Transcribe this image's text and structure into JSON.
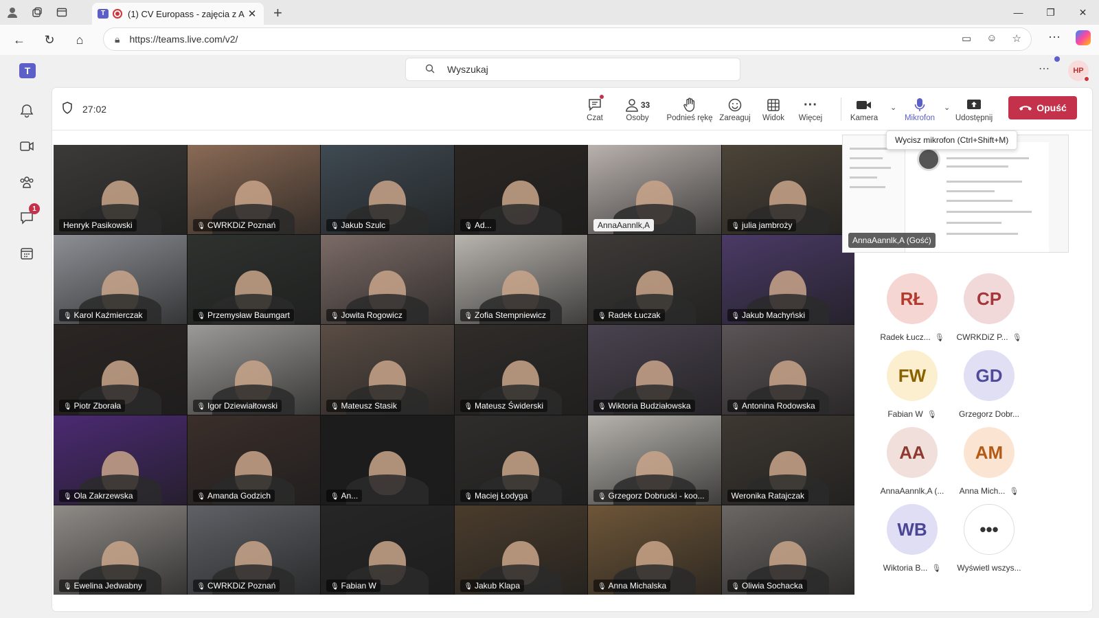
{
  "browser": {
    "tab_title": "(1) CV Europass - zajęcia z A",
    "url": "https://teams.live.com/v2/"
  },
  "teams": {
    "search_placeholder": "Wyszukaj",
    "user_initials": "HP",
    "chat_badge": "1"
  },
  "meeting": {
    "timer": "27:02",
    "people_count": "33",
    "toolbar": {
      "chat": "Czat",
      "people": "Osoby",
      "raise_hand": "Podnieś rękę",
      "react": "Zareaguj",
      "view": "Widok",
      "more": "Więcej",
      "camera": "Kamera",
      "mic": "Mikrofon",
      "share": "Udostępnij",
      "leave": "Opuść"
    },
    "tooltip": "Wycisz mikrofon (Ctrl+Shift+M)",
    "shared_label": "AnnaAannlk,A (Gość)",
    "tiles": [
      {
        "name": "Henryk Pasikowski",
        "muted": false,
        "bg": "#3b3a38",
        "light": false
      },
      {
        "name": "CWRKDiZ Poznań",
        "muted": true,
        "bg": "#8a6a55",
        "light": false
      },
      {
        "name": "Jakub Szulc",
        "muted": true,
        "bg": "#3f4a52",
        "light": false
      },
      {
        "name": "Ad...",
        "muted": true,
        "bg": "#2a2623",
        "light": false
      },
      {
        "name": "AnnaAannlk,A",
        "muted": false,
        "bg": "#b9b1ad",
        "light": true
      },
      {
        "name": "julia jambroży",
        "muted": true,
        "bg": "#4c4438",
        "light": false
      },
      {
        "name": "Karol Kaźmierczak",
        "muted": true,
        "bg": "#8c8f95",
        "light": false
      },
      {
        "name": "Przemysław Baumgart",
        "muted": true,
        "bg": "#2e322f",
        "light": false
      },
      {
        "name": "Jowita Rogowicz",
        "muted": true,
        "bg": "#7b6b66",
        "light": false
      },
      {
        "name": "Zofia Stempniewicz",
        "muted": true,
        "bg": "#b8b4ae",
        "light": false
      },
      {
        "name": "Radek Łuczak",
        "muted": true,
        "bg": "#3d3a37",
        "light": false
      },
      {
        "name": "Jakub Machyński",
        "muted": true,
        "bg": "#4a3a66",
        "light": false
      },
      {
        "name": "Piotr Zborała",
        "muted": true,
        "bg": "#2b2523",
        "light": false
      },
      {
        "name": "Igor Dziewiałtowski",
        "muted": true,
        "bg": "#9c9a98",
        "light": false
      },
      {
        "name": "Mateusz Stasik",
        "muted": true,
        "bg": "#5a4d45",
        "light": false
      },
      {
        "name": "Mateusz Świderski",
        "muted": true,
        "bg": "#2f2c29",
        "light": false
      },
      {
        "name": "Wiktoria Budziałowska",
        "muted": true,
        "bg": "#4a4350",
        "light": false
      },
      {
        "name": "Antonina Rodowska",
        "muted": true,
        "bg": "#5c5456",
        "light": false
      },
      {
        "name": "Ola Zakrzewska",
        "muted": true,
        "bg": "#4b2a73",
        "light": false
      },
      {
        "name": "Amanda Godzich",
        "muted": true,
        "bg": "#3a2e2a",
        "light": false
      },
      {
        "name": "An...",
        "muted": true,
        "bg": "#1c1c1c",
        "light": false
      },
      {
        "name": "Maciej Łodyga",
        "muted": true,
        "bg": "#2f2d2c",
        "light": false
      },
      {
        "name": "Grzegorz Dobrucki - koo...",
        "muted": true,
        "bg": "#b6b3ad",
        "light": false
      },
      {
        "name": "Weronika Ratajczak",
        "muted": false,
        "bg": "#3e3832",
        "light": false
      },
      {
        "name": "Ewelina Jedwabny",
        "muted": true,
        "bg": "#8f8b87",
        "light": false
      },
      {
        "name": "CWRKDiZ Poznań",
        "muted": true,
        "bg": "#5e6166",
        "light": false
      },
      {
        "name": "Fabian W",
        "muted": true,
        "bg": "#262626",
        "light": false
      },
      {
        "name": "Jakub Klapa",
        "muted": true,
        "bg": "#4a3c2c",
        "light": false
      },
      {
        "name": "Anna Michalska",
        "muted": true,
        "bg": "#6e5638",
        "light": false
      },
      {
        "name": "Oliwia Sochacka",
        "muted": true,
        "bg": "#6b6764",
        "light": false
      }
    ],
    "participants": [
      {
        "initials": "RŁ",
        "name": "Radek Łucz...",
        "muted": true,
        "bg": "#f6d6d2",
        "fg": "#b23b2e"
      },
      {
        "initials": "CP",
        "name": "CWRKDiZ P...",
        "muted": true,
        "bg": "#f2d9d9",
        "fg": "#a5373b"
      },
      {
        "initials": "FW",
        "name": "Fabian W",
        "muted": true,
        "bg": "#fbefcf",
        "fg": "#8a6100"
      },
      {
        "initials": "GD",
        "name": "Grzegorz Dobr...",
        "muted": false,
        "bg": "#e1dff3",
        "fg": "#4f4a9a"
      },
      {
        "initials": "AA",
        "name": "AnnaAannlk,A (...",
        "muted": false,
        "bg": "#f1dfdc",
        "fg": "#8d3a30"
      },
      {
        "initials": "AM",
        "name": "Anna Mich...",
        "muted": true,
        "bg": "#fbe5d2",
        "fg": "#b45a17"
      },
      {
        "initials": "WB",
        "name": "Wiktoria B...",
        "muted": true,
        "bg": "#e0def4",
        "fg": "#4a4594"
      },
      {
        "initials": "•••",
        "name": "Wyświetl wszys...",
        "muted": false,
        "bg": "#ffffff",
        "fg": "#333333"
      }
    ]
  }
}
